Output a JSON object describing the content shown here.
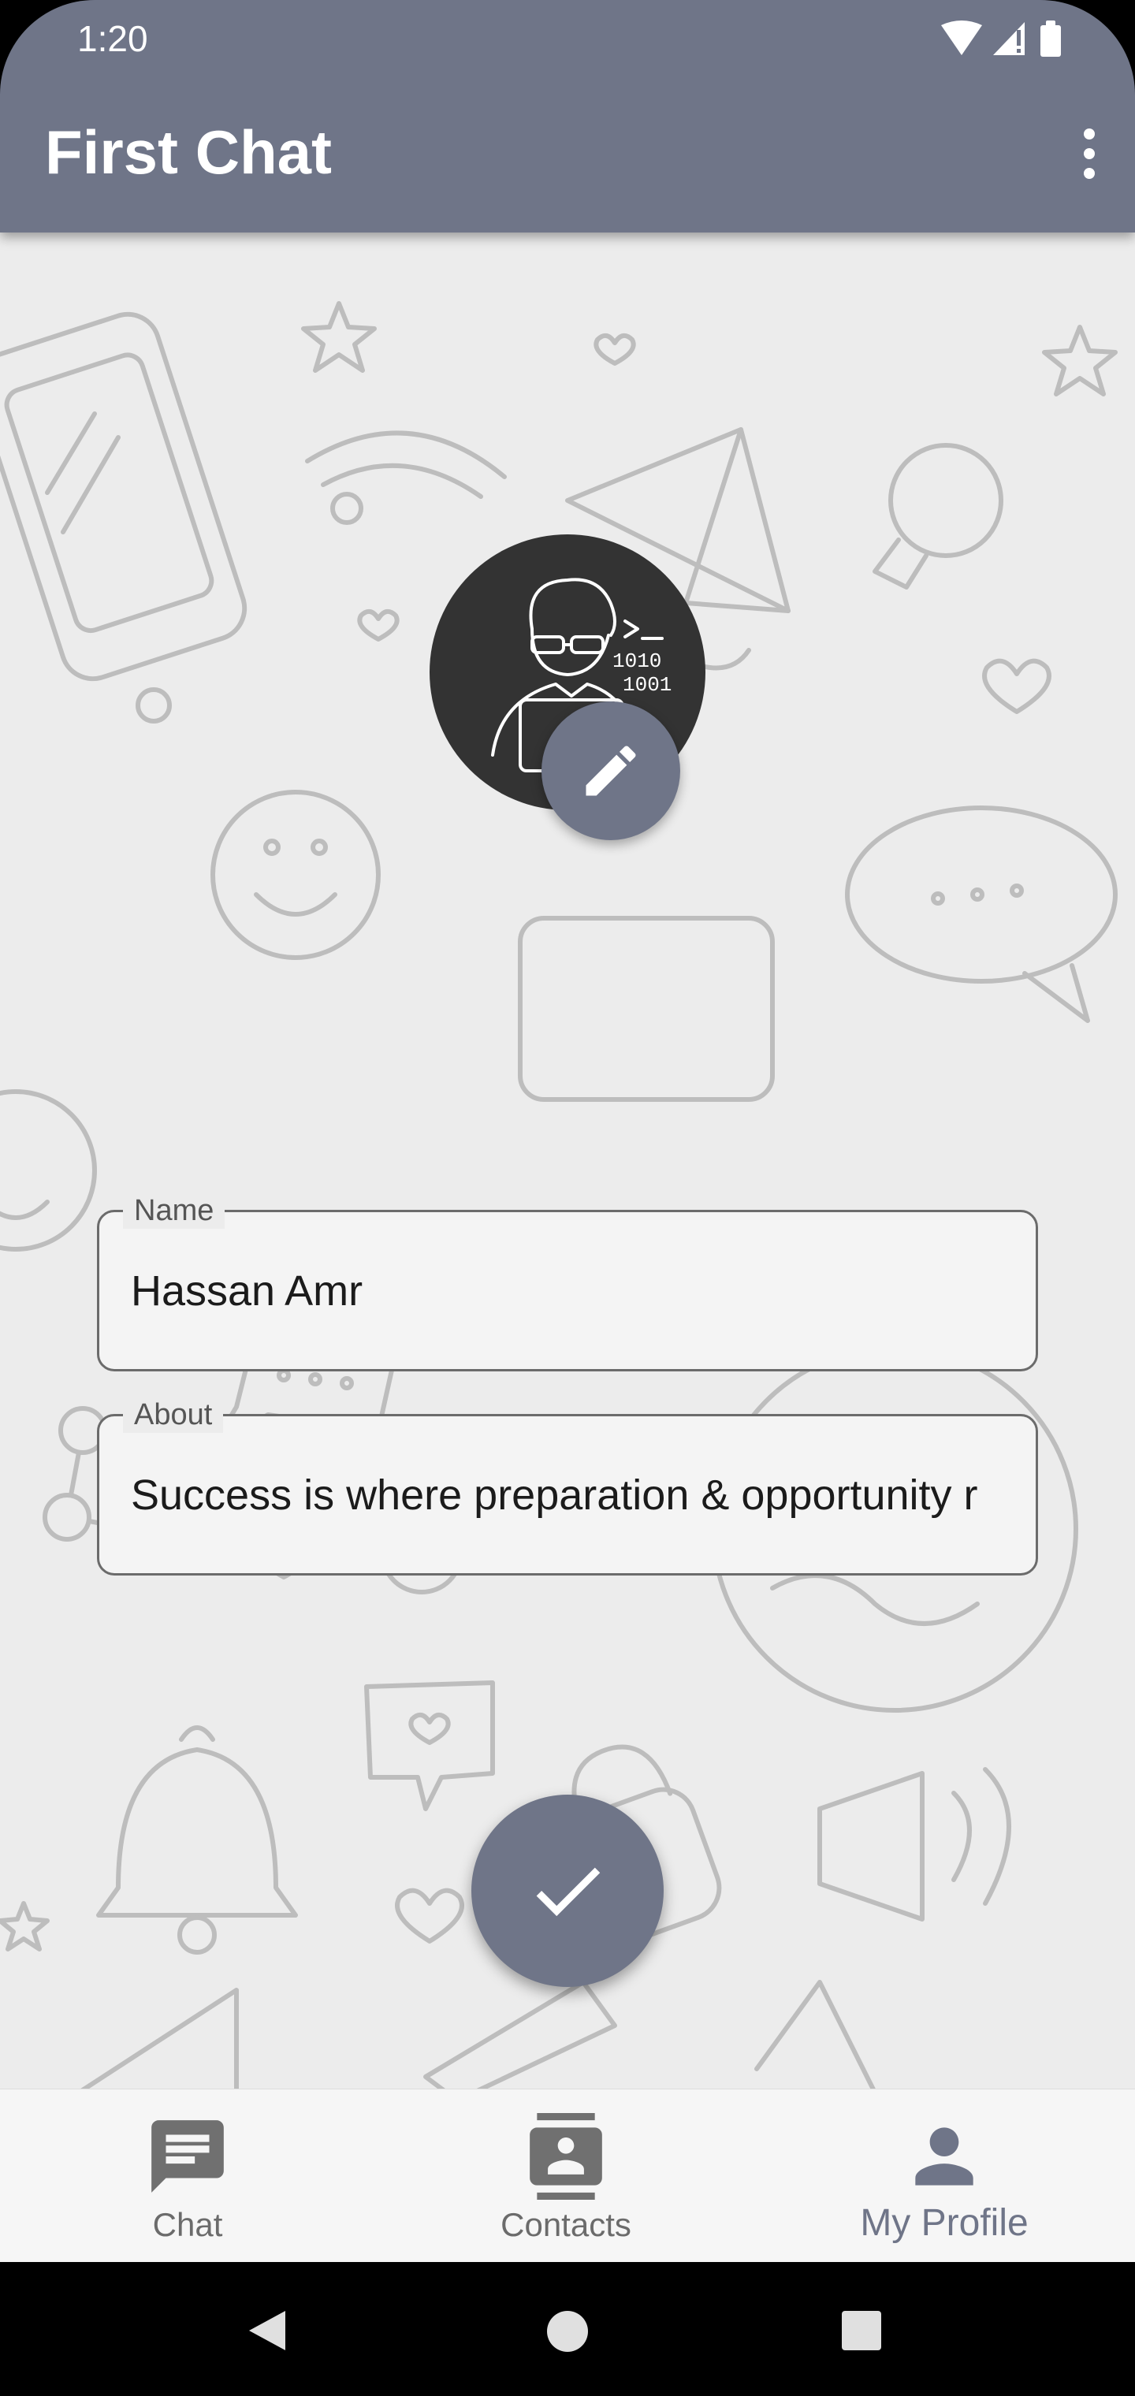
{
  "status_bar": {
    "time": "1:20",
    "icons": [
      "wifi-icon",
      "cellular-signal-icon",
      "battery-icon"
    ]
  },
  "app_bar": {
    "title": "First Chat",
    "menu_icon": "more-vert-icon"
  },
  "profile": {
    "avatar": "developer-avatar",
    "edit_icon": "pencil-icon",
    "name_field": {
      "label": "Name",
      "value": "Hassan Amr"
    },
    "about_field": {
      "label": "About",
      "value": "Success is where preparation & opportunity r"
    },
    "save_icon": "check-icon"
  },
  "bottom_nav": {
    "items": [
      {
        "label": "Chat",
        "icon": "chat-icon",
        "selected": false
      },
      {
        "label": "Contacts",
        "icon": "contacts-icon",
        "selected": false
      },
      {
        "label": "My Profile",
        "icon": "person-icon",
        "selected": true
      }
    ]
  },
  "system_nav": [
    "back-icon",
    "home-icon",
    "recents-icon"
  ],
  "colors": {
    "primary": "#6f7588",
    "background": "#ececec",
    "field_background": "#f4f4f4",
    "avatar_background": "#333333"
  }
}
